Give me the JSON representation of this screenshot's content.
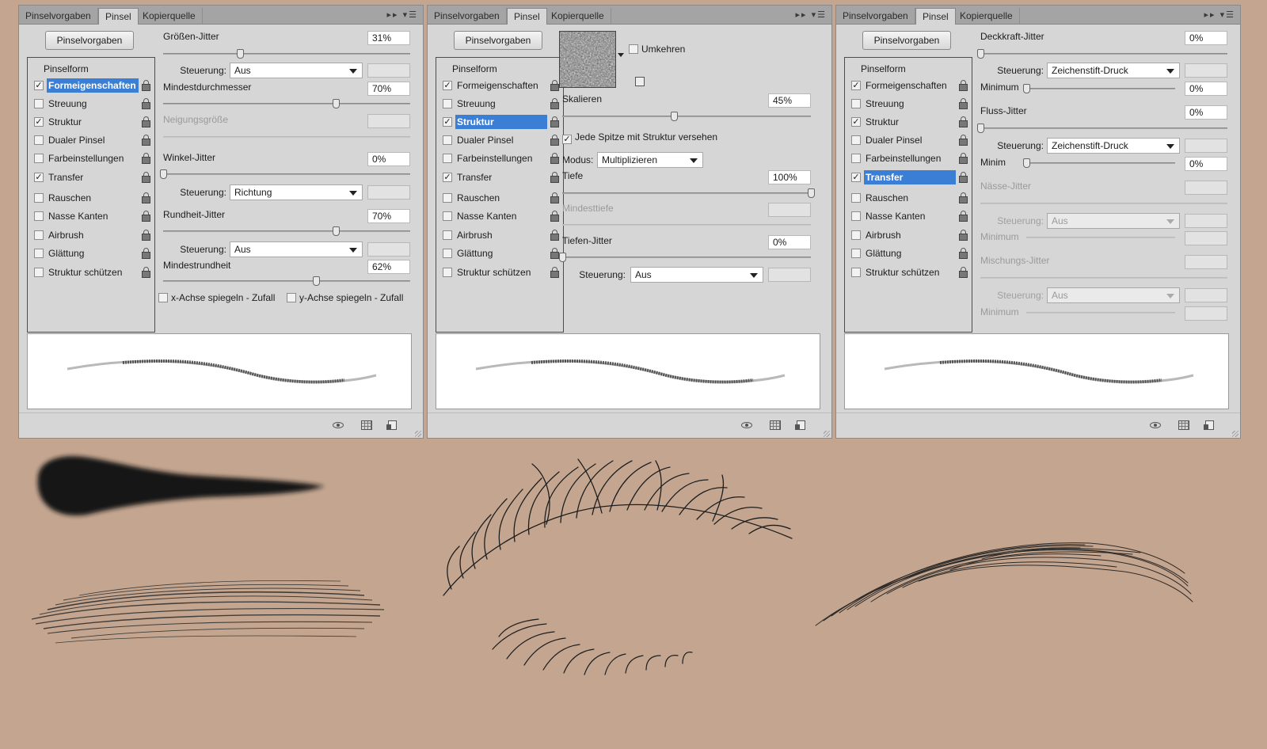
{
  "tabs": [
    "Pinselvorgaben",
    "Pinsel",
    "Kopierquelle"
  ],
  "presets_button": "Pinselvorgaben",
  "brush_list": {
    "header": "Pinselform",
    "items": [
      "Formeigenschaften",
      "Streuung",
      "Struktur",
      "Dualer Pinsel",
      "Farbeinstellungen",
      "Transfer",
      "Rauschen",
      "Nasse Kanten",
      "Airbrush",
      "Glättung",
      "Struktur schützen"
    ]
  },
  "panel1": {
    "checked": [
      true,
      false,
      true,
      false,
      false,
      true,
      false,
      false,
      false,
      false,
      false
    ],
    "selected_index": 0,
    "size_jitter": {
      "label": "Größen-Jitter",
      "value": "31%",
      "pos": 31
    },
    "control1": {
      "label": "Steuerung:",
      "value": "Aus"
    },
    "min_diameter": {
      "label": "Mindestdurchmesser",
      "value": "70%",
      "pos": 70
    },
    "tilt_scale": {
      "label": "Neigungsgröße"
    },
    "angle_jitter": {
      "label": "Winkel-Jitter",
      "value": "0%",
      "pos": 0
    },
    "control2": {
      "label": "Steuerung:",
      "value": "Richtung"
    },
    "roundness_jitter": {
      "label": "Rundheit-Jitter",
      "value": "70%",
      "pos": 70
    },
    "control3": {
      "label": "Steuerung:",
      "value": "Aus"
    },
    "min_roundness": {
      "label": "Mindestrundheit",
      "value": "62%",
      "pos": 62
    },
    "flip_x": "x-Achse spiegeln - Zufall",
    "flip_y": "y-Achse spiegeln - Zufall"
  },
  "panel2": {
    "checked": [
      true,
      false,
      true,
      false,
      false,
      true,
      false,
      false,
      false,
      false,
      false
    ],
    "selected_index": 2,
    "invert": "Umkehren",
    "scale": {
      "label": "Skalieren",
      "value": "45%",
      "pos": 45
    },
    "texture_each_tip": "Jede Spitze mit Struktur versehen",
    "mode": {
      "label": "Modus:",
      "value": "Multiplizieren"
    },
    "depth": {
      "label": "Tiefe",
      "value": "100%",
      "pos": 100
    },
    "min_depth": {
      "label": "Mindesttiefe"
    },
    "depth_jitter": {
      "label": "Tiefen-Jitter",
      "value": "0%",
      "pos": 0
    },
    "control": {
      "label": "Steuerung:",
      "value": "Aus"
    }
  },
  "panel3": {
    "checked": [
      true,
      false,
      true,
      false,
      false,
      true,
      false,
      false,
      false,
      false,
      false
    ],
    "selected_index": 5,
    "opacity_jitter": {
      "label": "Deckkraft-Jitter",
      "value": "0%",
      "pos": 0
    },
    "control1": {
      "label": "Steuerung:",
      "value": "Zeichenstift-Druck"
    },
    "minimum1": {
      "label": "Minimum",
      "value": "0%",
      "pos": 0
    },
    "flow_jitter": {
      "label": "Fluss-Jitter",
      "value": "0%",
      "pos": 0
    },
    "control2": {
      "label": "Steuerung:",
      "value": "Zeichenstift-Druck"
    },
    "minimum2": {
      "label": "Minim",
      "value": "0%",
      "pos": 0
    },
    "wet_jitter": {
      "label": "Nässe-Jitter"
    },
    "control3": {
      "label": "Steuerung:",
      "value": "Aus"
    },
    "minimum3": {
      "label": "Minimum"
    },
    "mix_jitter": {
      "label": "Mischungs-Jitter"
    },
    "control4": {
      "label": "Steuerung:",
      "value": "Aus"
    },
    "minimum4": {
      "label": "Minimum"
    }
  },
  "colors": {
    "background": "#c4a690",
    "panel": "#d6d6d6",
    "selection": "#3a7fd5"
  },
  "icons": {
    "tab_menu": "double-arrow-menu-icon",
    "lock": "lock-icon",
    "footer": [
      "eye-brush-icon",
      "grid-icon",
      "new-preset-icon"
    ]
  }
}
